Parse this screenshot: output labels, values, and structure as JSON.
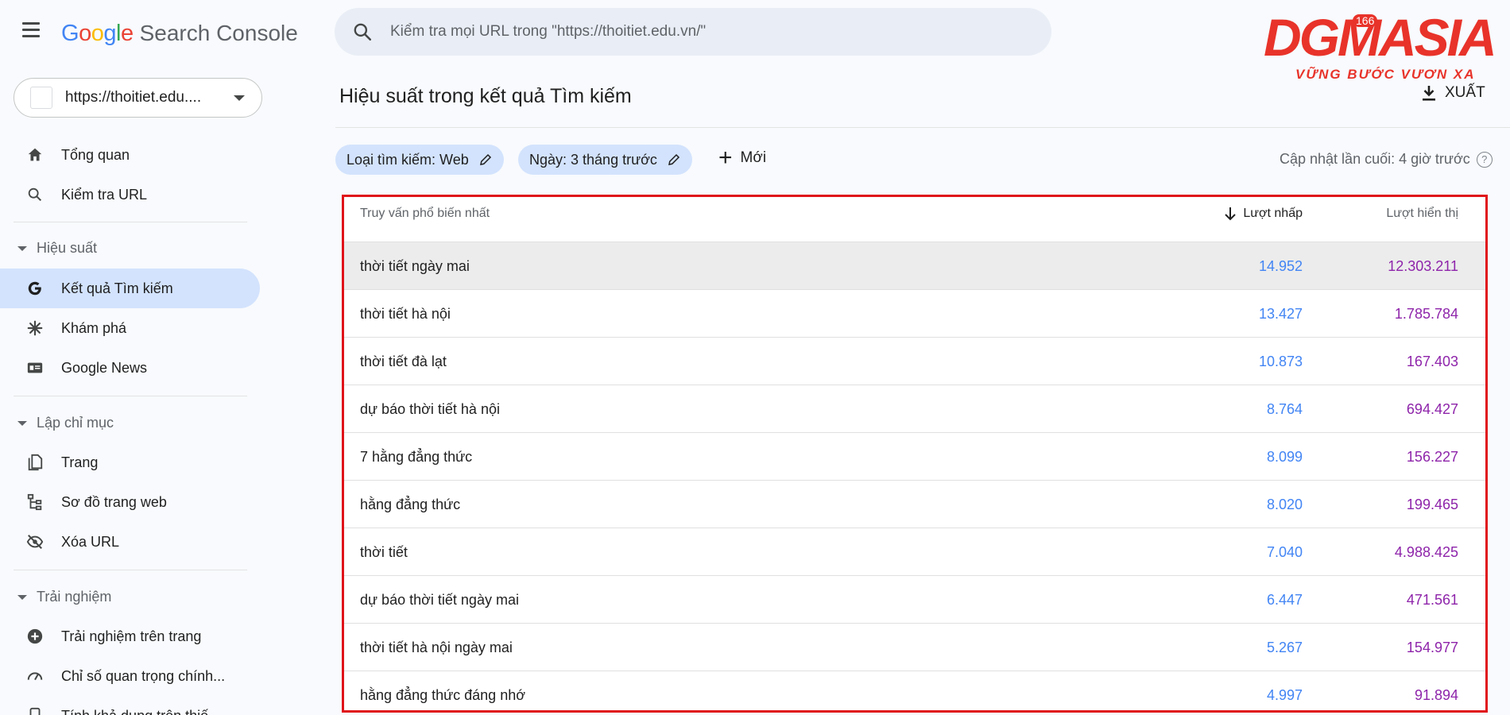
{
  "header": {
    "logo": {
      "g1": "G",
      "o1": "o",
      "o2": "o",
      "g2": "g",
      "l": "l",
      "e": "e",
      "product": "Search Console"
    },
    "search_placeholder": "Kiểm tra mọi URL trong \"https://thoitiet.edu.vn/\""
  },
  "brand": {
    "word": "DGMASIA",
    "tagline": "VỮNG BƯỚC VƯƠN XA",
    "badge": "166"
  },
  "property": {
    "url": "https://thoitiet.edu...."
  },
  "sidebar": {
    "items": [
      {
        "label": "Tổng quan",
        "icon": "home-icon"
      },
      {
        "label": "Kiểm tra URL",
        "icon": "search-icon"
      }
    ],
    "sections": [
      {
        "label": "Hiệu suất",
        "items": [
          {
            "label": "Kết quả Tìm kiếm",
            "icon": "google-g-icon",
            "active": true
          },
          {
            "label": "Khám phá",
            "icon": "asterisk-icon"
          },
          {
            "label": "Google News",
            "icon": "news-icon"
          }
        ]
      },
      {
        "label": "Lập chỉ mục",
        "items": [
          {
            "label": "Trang",
            "icon": "pages-icon"
          },
          {
            "label": "Sơ đồ trang web",
            "icon": "sitemap-icon"
          },
          {
            "label": "Xóa URL",
            "icon": "eye-off-icon"
          }
        ]
      },
      {
        "label": "Trải nghiệm",
        "items": [
          {
            "label": "Trải nghiệm trên trang",
            "icon": "badge-plus-icon"
          },
          {
            "label": "Chỉ số quan trọng chính...",
            "icon": "gauge-icon"
          },
          {
            "label": "Tính khả dụng trên thiế",
            "icon": "phone-icon"
          }
        ]
      }
    ]
  },
  "main": {
    "title": "Hiệu suất trong kết quả Tìm kiếm",
    "export_label": "XUẤT",
    "chips": [
      {
        "label": "Loại tìm kiếm: Web"
      },
      {
        "label": "Ngày: 3 tháng trước"
      }
    ],
    "new_label": "Mới",
    "updated": "Cập nhật lần cuối: 4 giờ trước",
    "table": {
      "headers": {
        "query": "Truy vấn phổ biến nhất",
        "clicks": "Lượt nhấp",
        "impressions": "Lượt hiển thị"
      },
      "rows": [
        {
          "query": "thời tiết ngày mai",
          "clicks": "14.952",
          "impressions": "12.303.211"
        },
        {
          "query": "thời tiết hà nội",
          "clicks": "13.427",
          "impressions": "1.785.784"
        },
        {
          "query": "thời tiết đà lạt",
          "clicks": "10.873",
          "impressions": "167.403"
        },
        {
          "query": "dự báo thời tiết hà nội",
          "clicks": "8.764",
          "impressions": "694.427"
        },
        {
          "query": "7 hằng đẳng thức",
          "clicks": "8.099",
          "impressions": "156.227"
        },
        {
          "query": "hằng đẳng thức",
          "clicks": "8.020",
          "impressions": "199.465"
        },
        {
          "query": "thời tiết",
          "clicks": "7.040",
          "impressions": "4.988.425"
        },
        {
          "query": "dự báo thời tiết ngày mai",
          "clicks": "6.447",
          "impressions": "471.561"
        },
        {
          "query": "thời tiết hà nội ngày mai",
          "clicks": "5.267",
          "impressions": "154.977"
        },
        {
          "query": "hằng đẳng thức đáng nhớ",
          "clicks": "4.997",
          "impressions": "91.894"
        }
      ]
    }
  },
  "colors": {
    "accent": "#d3e3fd",
    "clicks": "#4285f4",
    "impressions": "#8e24aa",
    "highlight_border": "#e0131a"
  }
}
